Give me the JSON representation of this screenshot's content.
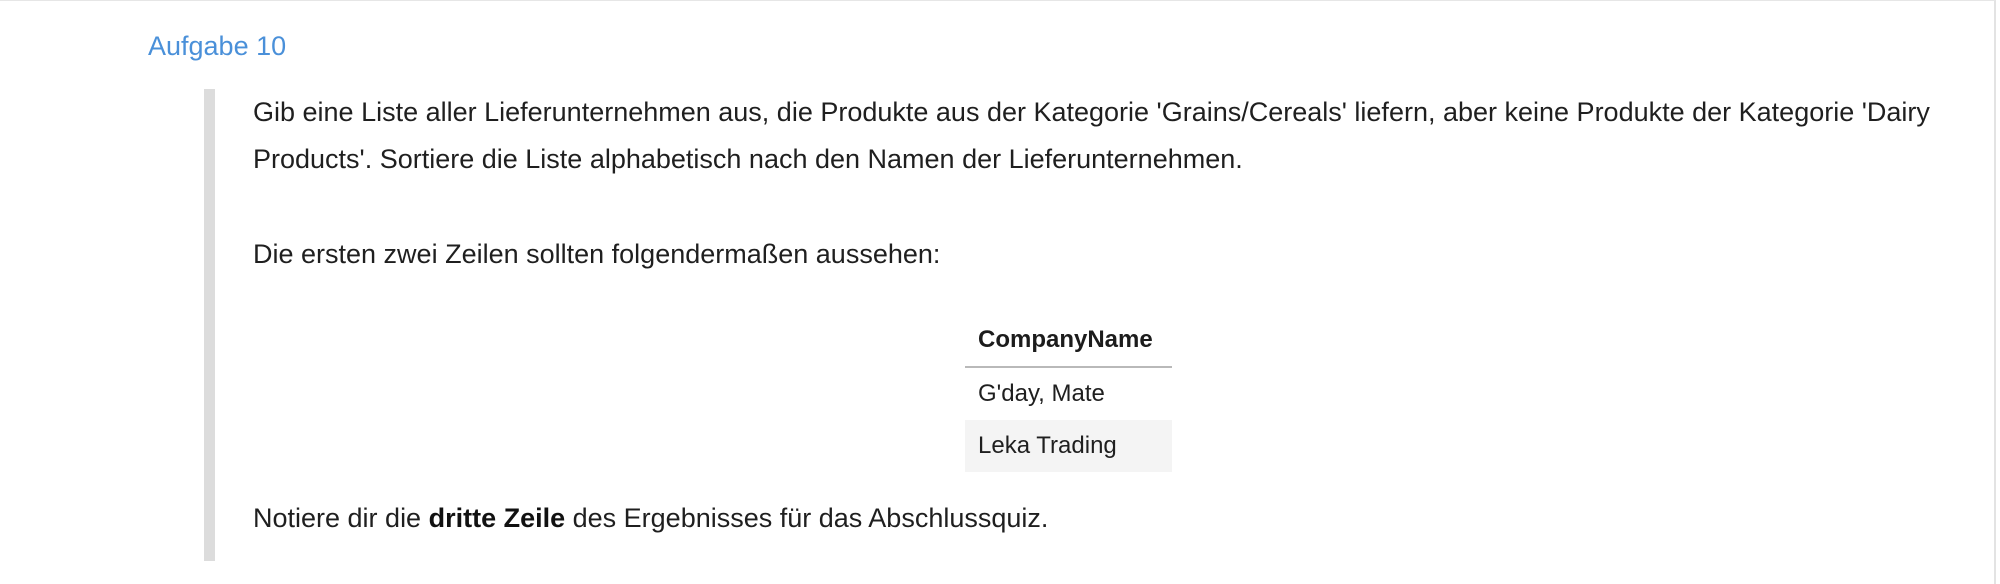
{
  "task": {
    "heading": "Aufgabe 10",
    "intro": "Gib eine Liste aller Lieferunternehmen aus, die Produkte aus der Kategorie 'Grains/Cereals' liefern, aber keine Produkte der Kategorie 'Dairy Products'. Sortiere die Liste alphabetisch nach den Namen der Lieferunternehmen.",
    "example_intro": "Die ersten zwei Zeilen sollten folgendermaßen aussehen:",
    "table": {
      "header": "CompanyName",
      "rows": [
        "G'day, Mate",
        "Leka Trading"
      ]
    },
    "note_prefix": "Notiere dir die ",
    "note_bold": "dritte Zeile",
    "note_suffix": " des Ergebnisses für das Abschlussquiz."
  },
  "colors": {
    "heading": "#4a90d9",
    "quote_bar": "#dcdcdc",
    "alt_row": "#f4f4f4"
  }
}
